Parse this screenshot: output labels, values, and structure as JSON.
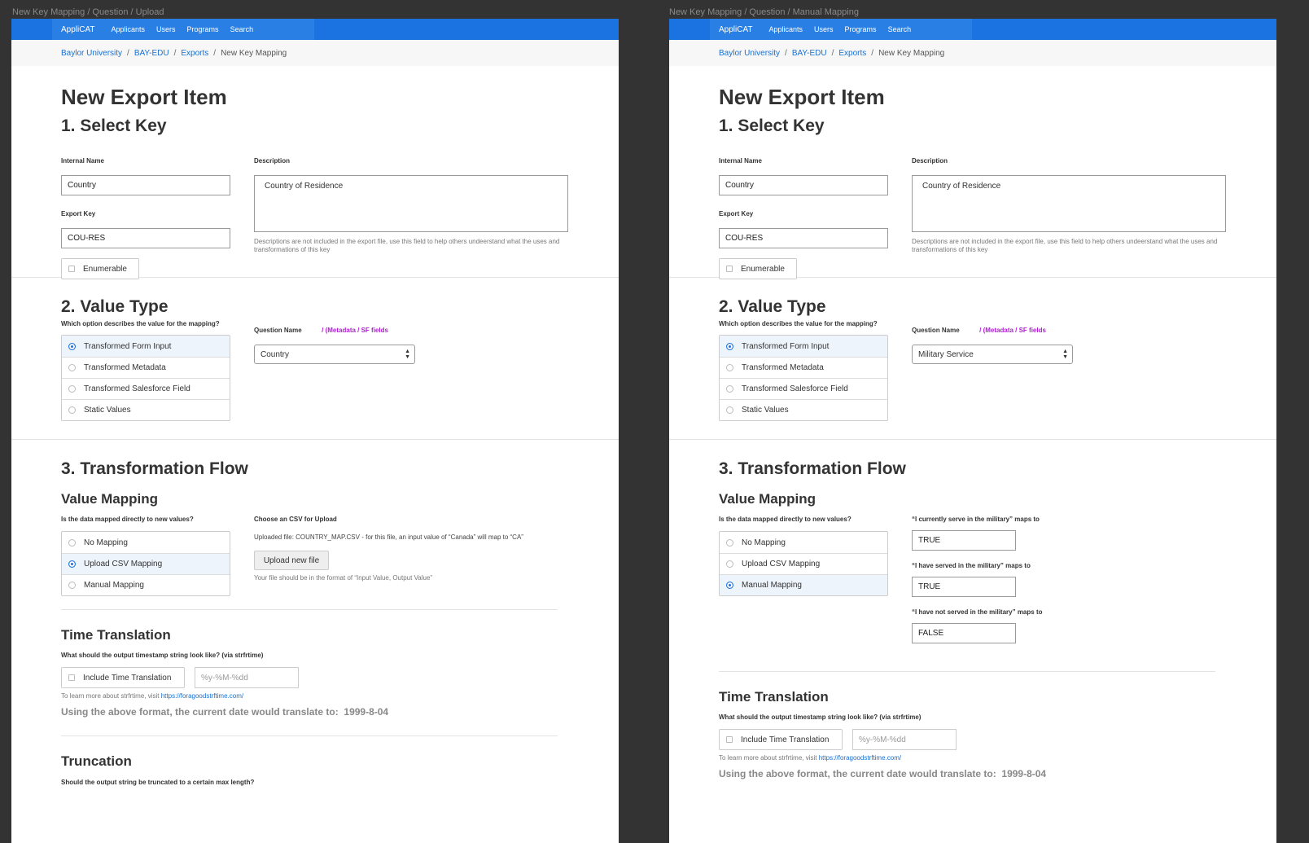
{
  "left_label": "New Key Mapping / Question / Upload",
  "right_label": "New Key Mapping / Question / Manual Mapping",
  "nav": {
    "brand": "AppliCAT",
    "items": [
      "Applicants",
      "Users",
      "Programs",
      "Search"
    ]
  },
  "breadcrumb": {
    "items": [
      "Baylor University",
      "BAY-EDU",
      "Exports"
    ],
    "current": "New Key Mapping"
  },
  "page_title": "New Export Item",
  "section1": {
    "title": "1. Select Key",
    "internal_name_label": "Internal Name",
    "internal_name_value": "Country",
    "export_key_label": "Export Key",
    "export_key_value": "COU-RES",
    "enumerable_label": "Enumerable",
    "description_label": "Description",
    "description_value": "Country of Residence",
    "description_help": "Descriptions are not included in the export file, use this field to help others undeerstand what the uses and transformations of this key"
  },
  "section2": {
    "title": "2. Value Type",
    "question": "Which option describes the value for the mapping?",
    "options": [
      "Transformed Form Input",
      "Transformed Metadata",
      "Transformed Salesforce Field",
      "Static Values"
    ],
    "question_name_label": "Question Name",
    "metadata_link": "/ (Metadata / SF fields",
    "left_select": "Country",
    "right_select": "Military Service"
  },
  "section3": {
    "title": "3. Transformation Flow",
    "value_mapping_title": "Value Mapping",
    "value_mapping_question": "Is the data mapped directly to new values?",
    "mapping_options": [
      "No Mapping",
      "Upload CSV Mapping",
      "Manual Mapping"
    ],
    "csv_label": "Choose an CSV for Upload",
    "csv_uploaded": "Uploaded file: COUNTRY_MAP.CSV - for this file, an input value of “Canada” will map to “CA”",
    "upload_button": "Upload new file",
    "csv_help": "Your file should be in the format of “Input Value, Output Value”",
    "manual_maps": [
      {
        "label": "“I currently serve in the military” maps to",
        "value": "TRUE"
      },
      {
        "label": "“I have served in the military” maps to",
        "value": "TRUE"
      },
      {
        "label": "“I have not served in the military” maps to",
        "value": "FALSE"
      }
    ],
    "time_title": "Time Translation",
    "time_question": "What should the output timestamp string look like? (via strfrtime)",
    "time_checkbox": "Include Time Translation",
    "time_placeholder": "%y-%M-%dd",
    "time_help_prefix": "To learn more about strfrtime, visit ",
    "time_help_link": "https://foragoodstrftime.com/",
    "time_result_label": "Using the above format, the current date would translate to:",
    "time_result_value": "1999-8-04",
    "truncation_title": "Truncation",
    "truncation_question": "Should the output string be truncated to a certain max length?"
  },
  "colors": {
    "nav": "#1a73e0",
    "link": "#1a6fce",
    "accent_purple": "#b01ed3"
  }
}
